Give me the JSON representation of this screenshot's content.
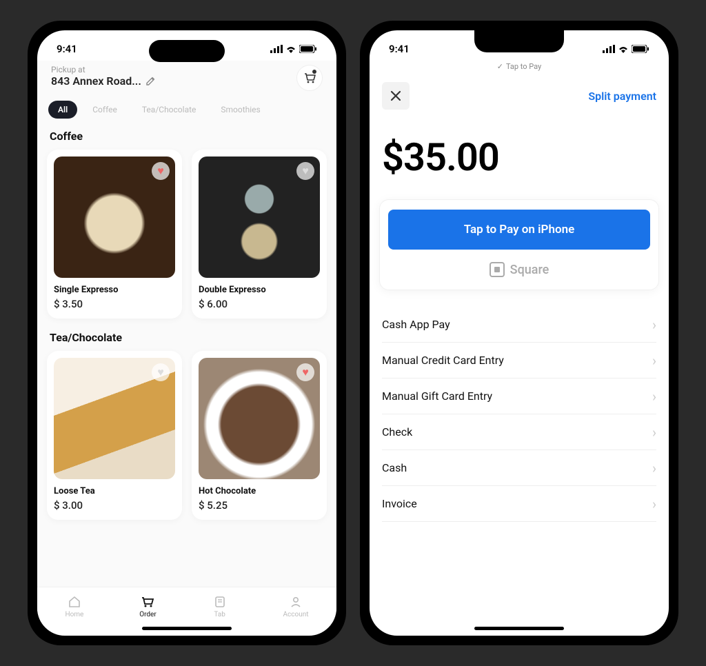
{
  "status": {
    "time": "9:41"
  },
  "left": {
    "pickup_label": "Pickup at",
    "pickup_address": "843 Annex Road...",
    "tabs": [
      "All",
      "Coffee",
      "Tea/Chocolate",
      "Smoothies"
    ],
    "section1_title": "Coffee",
    "section2_title": "Tea/Chocolate",
    "products": [
      {
        "name": "Single Expresso",
        "price": "$ 3.50"
      },
      {
        "name": "Double Expresso",
        "price": "$ 6.00"
      },
      {
        "name": "Loose Tea",
        "price": "$ 3.00"
      },
      {
        "name": "Hot Chocolate",
        "price": "$ 5.25"
      }
    ],
    "nav": [
      "Home",
      "Order",
      "Tab",
      "Account"
    ]
  },
  "right": {
    "top_hint": "Tap to Pay",
    "split_label": "Split payment",
    "amount": "$35.00",
    "tap_button": "Tap to Pay on iPhone",
    "provider": "Square",
    "options": [
      "Cash App Pay",
      "Manual Credit Card Entry",
      "Manual Gift Card Entry",
      "Check",
      "Cash",
      "Invoice"
    ]
  }
}
